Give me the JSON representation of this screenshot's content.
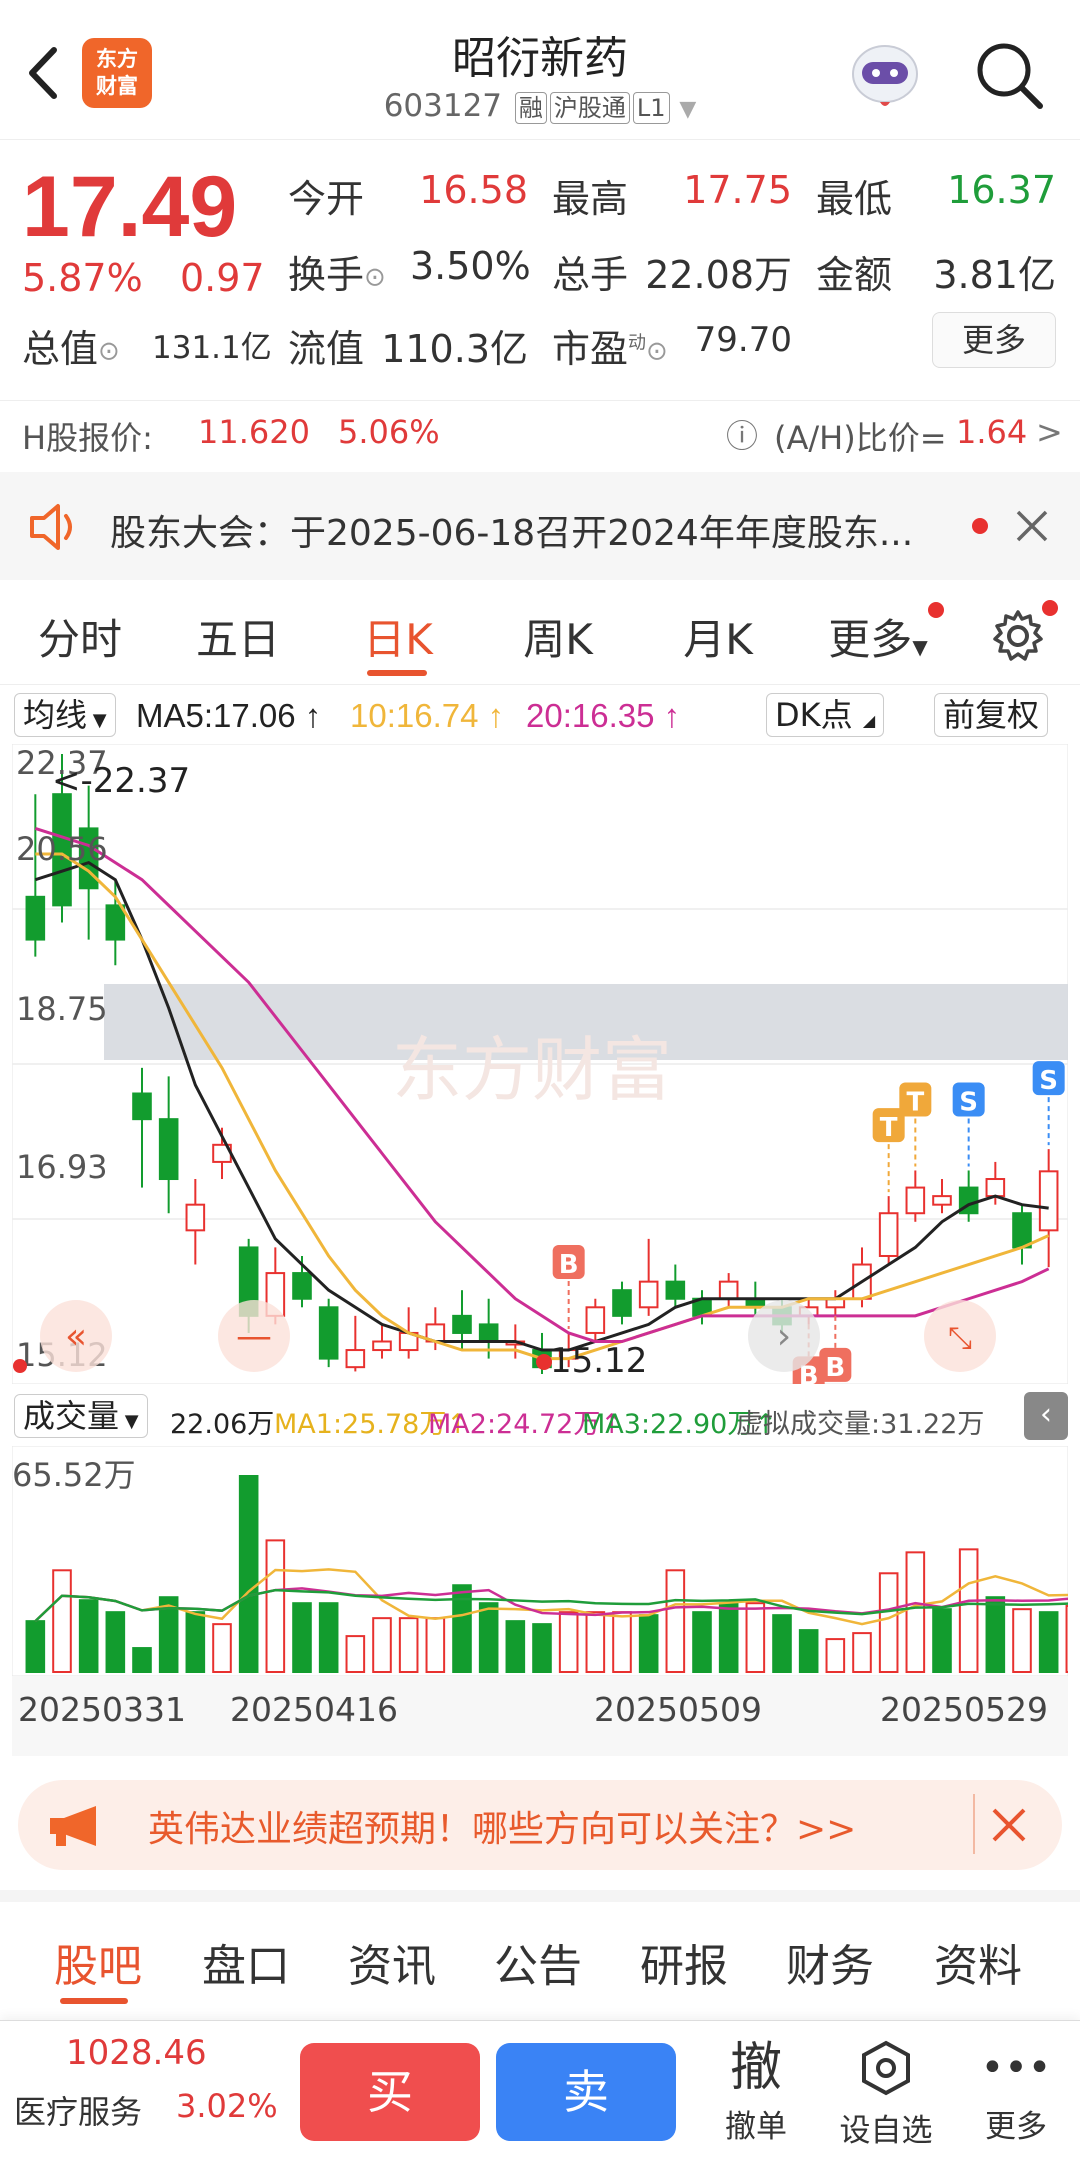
{
  "header": {
    "logo_line1": "东方",
    "logo_line2": "财富",
    "title": "昭衍新药",
    "code": "603127",
    "tags": [
      "融",
      "沪股通",
      "L1"
    ]
  },
  "quote": {
    "price": "17.49",
    "change_pct": "5.87%",
    "change": "0.97",
    "open_label": "今开",
    "open": "16.58",
    "high_label": "最高",
    "high": "17.75",
    "low_label": "最低",
    "low": "16.37",
    "turnover_label": "换手",
    "turnover": "3.50%",
    "volume_label": "总手",
    "volume": "22.08万",
    "amount_label": "金额",
    "amount": "3.81亿",
    "mcap_label": "总值",
    "mcap": "131.1亿",
    "float_label": "流值",
    "float_mcap": "110.3亿",
    "pe_label": "市盈",
    "pe_sup": "动",
    "pe": "79.70",
    "more_button": "更多"
  },
  "hshare": {
    "label": "H股报价:",
    "price": "11.620",
    "pct": "5.06%",
    "ah_label": "(A/H)比价=",
    "ah_value": "1.64",
    "arrow": ">"
  },
  "notice": {
    "text": "股东大会：于2025-06-18召开2024年年度股东..."
  },
  "ktabs": [
    "分时",
    "五日",
    "日K",
    "周K",
    "月K",
    "更多"
  ],
  "ma_bar": {
    "selector": "均线",
    "ma5": "MA5:17.06",
    "ma10": "10:16.74",
    "ma20": "20:16.35",
    "dk_button": "DK点",
    "fq_button": "前复权"
  },
  "chart_labels": {
    "y_max": "22.37",
    "y_2": "20.56",
    "y_3": "18.75",
    "y_4": "16.93",
    "y_min": "15.12",
    "max_note": "<-22.37",
    "min_note": "15.12"
  },
  "vol_bar": {
    "selector": "成交量",
    "vol": "22.06万",
    "ma1": "MA1:25.78万",
    "ma2": "MA2:24.72万",
    "ma3": "MA3:22.90万",
    "virtual": "虚拟成交量:31.22万",
    "y_max": "65.52万"
  },
  "dates": [
    "20250331",
    "20250416",
    "20250509",
    "20250529"
  ],
  "ad": {
    "text": "英伟达业绩超预期！哪些方向可以关注？>>"
  },
  "subtabs": [
    "股吧",
    "盘口",
    "资讯",
    "公告",
    "研报",
    "财务",
    "资料"
  ],
  "bottom": {
    "index_value": "1028.46",
    "index_name": "医疗服务",
    "index_pct": "3.02%",
    "buy": "买",
    "sell": "卖",
    "cancel_glyph": "撤",
    "cancel_label": "撤单",
    "watch_label": "设自选",
    "more_label": "更多"
  },
  "chart_data": {
    "type": "candlestick",
    "title": "",
    "y_range": [
      15.12,
      22.37
    ],
    "candles": [
      {
        "o": 20.2,
        "c": 20.7,
        "h": 21.9,
        "l": 20.0,
        "up": false
      },
      {
        "o": 21.9,
        "c": 20.6,
        "h": 22.37,
        "l": 20.4,
        "up": false
      },
      {
        "o": 21.5,
        "c": 20.8,
        "h": 22.0,
        "l": 20.2,
        "up": false
      },
      {
        "o": 20.6,
        "c": 20.2,
        "h": 20.9,
        "l": 19.9,
        "up": false
      },
      {
        "o": 18.4,
        "c": 18.1,
        "h": 18.7,
        "l": 17.3,
        "up": false
      },
      {
        "o": 18.1,
        "c": 17.4,
        "h": 18.6,
        "l": 17.0,
        "up": false
      },
      {
        "o": 16.8,
        "c": 17.1,
        "h": 17.4,
        "l": 16.4,
        "up": true
      },
      {
        "o": 17.6,
        "c": 17.8,
        "h": 18.0,
        "l": 17.4,
        "up": true
      },
      {
        "o": 16.6,
        "c": 15.8,
        "h": 16.7,
        "l": 15.6,
        "up": false
      },
      {
        "o": 15.8,
        "c": 16.3,
        "h": 16.6,
        "l": 15.7,
        "up": true
      },
      {
        "o": 16.3,
        "c": 16.0,
        "h": 16.5,
        "l": 15.9,
        "up": false
      },
      {
        "o": 15.9,
        "c": 15.3,
        "h": 16.0,
        "l": 15.2,
        "up": false
      },
      {
        "o": 15.2,
        "c": 15.4,
        "h": 15.8,
        "l": 15.15,
        "up": true
      },
      {
        "o": 15.4,
        "c": 15.5,
        "h": 15.7,
        "l": 15.3,
        "up": true
      },
      {
        "o": 15.4,
        "c": 15.6,
        "h": 15.9,
        "l": 15.3,
        "up": true
      },
      {
        "o": 15.5,
        "c": 15.7,
        "h": 15.9,
        "l": 15.4,
        "up": true
      },
      {
        "o": 15.8,
        "c": 15.6,
        "h": 16.1,
        "l": 15.4,
        "up": false
      },
      {
        "o": 15.7,
        "c": 15.5,
        "h": 16.0,
        "l": 15.3,
        "up": false
      },
      {
        "o": 15.5,
        "c": 15.5,
        "h": 15.7,
        "l": 15.3,
        "up": true
      },
      {
        "o": 15.4,
        "c": 15.2,
        "h": 15.6,
        "l": 15.12,
        "up": false
      },
      {
        "o": 15.3,
        "c": 15.4,
        "h": 15.6,
        "l": 15.2,
        "up": true
      },
      {
        "o": 15.6,
        "c": 15.9,
        "h": 16.0,
        "l": 15.5,
        "up": true
      },
      {
        "o": 16.1,
        "c": 15.8,
        "h": 16.2,
        "l": 15.7,
        "up": false
      },
      {
        "o": 15.9,
        "c": 16.2,
        "h": 16.7,
        "l": 15.8,
        "up": true
      },
      {
        "o": 16.2,
        "c": 16.0,
        "h": 16.4,
        "l": 15.9,
        "up": false
      },
      {
        "o": 15.8,
        "c": 16.0,
        "h": 16.1,
        "l": 15.7,
        "up": false
      },
      {
        "o": 16.0,
        "c": 16.2,
        "h": 16.3,
        "l": 15.9,
        "up": true
      },
      {
        "o": 16.0,
        "c": 15.9,
        "h": 16.2,
        "l": 15.8,
        "up": false
      },
      {
        "o": 15.9,
        "c": 15.7,
        "h": 16.0,
        "l": 15.6,
        "up": false
      },
      {
        "o": 15.8,
        "c": 15.9,
        "h": 16.0,
        "l": 15.7,
        "up": true
      },
      {
        "o": 15.9,
        "c": 16.0,
        "h": 16.1,
        "l": 15.8,
        "up": true
      },
      {
        "o": 16.0,
        "c": 16.4,
        "h": 16.6,
        "l": 15.9,
        "up": true
      },
      {
        "o": 16.5,
        "c": 17.0,
        "h": 17.2,
        "l": 16.4,
        "up": true
      },
      {
        "o": 17.0,
        "c": 17.3,
        "h": 17.5,
        "l": 16.9,
        "up": true
      },
      {
        "o": 17.1,
        "c": 17.2,
        "h": 17.4,
        "l": 17.0,
        "up": true
      },
      {
        "o": 17.3,
        "c": 17.0,
        "h": 17.5,
        "l": 16.9,
        "up": false
      },
      {
        "o": 17.4,
        "c": 17.2,
        "h": 17.6,
        "l": 17.1,
        "up": true
      },
      {
        "o": 17.0,
        "c": 16.6,
        "h": 17.1,
        "l": 16.4,
        "up": false
      },
      {
        "o": 16.8,
        "c": 17.49,
        "h": 17.75,
        "l": 16.37,
        "up": true
      }
    ],
    "ma_series": [
      {
        "name": "MA5",
        "color": "#222222",
        "values": [
          20.9,
          21.0,
          21.1,
          20.9,
          20.2,
          19.4,
          18.5,
          17.9,
          17.3,
          16.7,
          16.4,
          16.1,
          15.9,
          15.7,
          15.6,
          15.5,
          15.5,
          15.5,
          15.5,
          15.4,
          15.4,
          15.5,
          15.6,
          15.7,
          15.9,
          16.0,
          16.0,
          16.0,
          16.0,
          16.0,
          16.0,
          16.2,
          16.4,
          16.6,
          16.9,
          17.1,
          17.2,
          17.1,
          17.06
        ]
      },
      {
        "name": "MA10",
        "color": "#f0b63a",
        "values": [
          21.2,
          21.2,
          21.0,
          20.7,
          20.2,
          19.7,
          19.2,
          18.7,
          18.1,
          17.5,
          17.0,
          16.5,
          16.1,
          15.8,
          15.6,
          15.5,
          15.4,
          15.4,
          15.4,
          15.3,
          15.3,
          15.4,
          15.5,
          15.6,
          15.7,
          15.8,
          15.9,
          15.9,
          15.9,
          16.0,
          16.0,
          16.0,
          16.1,
          16.2,
          16.3,
          16.4,
          16.5,
          16.6,
          16.74
        ]
      },
      {
        "name": "MA20",
        "color": "#cc2e94",
        "values": [
          21.5,
          21.4,
          21.3,
          21.1,
          20.9,
          20.6,
          20.3,
          20.0,
          19.7,
          19.3,
          18.9,
          18.5,
          18.1,
          17.7,
          17.3,
          16.9,
          16.6,
          16.3,
          16.0,
          15.8,
          15.6,
          15.5,
          15.5,
          15.6,
          15.7,
          15.8,
          15.8,
          15.8,
          15.8,
          15.8,
          15.8,
          15.8,
          15.8,
          15.8,
          15.9,
          16.0,
          16.1,
          16.2,
          16.35
        ]
      }
    ],
    "volumes": [
      {
        "v": 17,
        "up": false
      },
      {
        "v": 34,
        "up": true
      },
      {
        "v": 24,
        "up": false
      },
      {
        "v": 20,
        "up": false
      },
      {
        "v": 8,
        "up": false
      },
      {
        "v": 25,
        "up": false
      },
      {
        "v": 20,
        "up": false
      },
      {
        "v": 16,
        "up": true
      },
      {
        "v": 65.52,
        "up": false
      },
      {
        "v": 44,
        "up": true
      },
      {
        "v": 23,
        "up": false
      },
      {
        "v": 23,
        "up": false
      },
      {
        "v": 12,
        "up": true
      },
      {
        "v": 18,
        "up": true
      },
      {
        "v": 18,
        "up": true
      },
      {
        "v": 18,
        "up": true
      },
      {
        "v": 29,
        "up": false
      },
      {
        "v": 23,
        "up": false
      },
      {
        "v": 17,
        "up": false
      },
      {
        "v": 16,
        "up": false
      },
      {
        "v": 20,
        "up": true
      },
      {
        "v": 20,
        "up": true
      },
      {
        "v": 20,
        "up": true
      },
      {
        "v": 19,
        "up": false
      },
      {
        "v": 34,
        "up": true
      },
      {
        "v": 20,
        "up": false
      },
      {
        "v": 23,
        "up": false
      },
      {
        "v": 23,
        "up": true
      },
      {
        "v": 19,
        "up": false
      },
      {
        "v": 14,
        "up": false
      },
      {
        "v": 11,
        "up": true
      },
      {
        "v": 13,
        "up": true
      },
      {
        "v": 33,
        "up": true
      },
      {
        "v": 40,
        "up": true
      },
      {
        "v": 21,
        "up": false
      },
      {
        "v": 41,
        "up": true
      },
      {
        "v": 25,
        "up": false
      },
      {
        "v": 21,
        "up": true
      },
      {
        "v": 20,
        "up": false
      },
      {
        "v": 22.06,
        "up": true
      }
    ],
    "signals": [
      {
        "i": 20,
        "text": "B",
        "color": "#ef6f5f"
      },
      {
        "i": 29,
        "text": "B",
        "color": "#ef6f5f"
      },
      {
        "i": 30,
        "text": "B",
        "color": "#ef6f5f"
      },
      {
        "i": 32,
        "text": "T",
        "color": "#f0a83a"
      },
      {
        "i": 33,
        "text": "T",
        "color": "#f0a83a"
      },
      {
        "i": 35,
        "text": "S",
        "color": "#3a8df5"
      },
      {
        "i": 38,
        "text": "S",
        "color": "#3a8df5"
      }
    ]
  }
}
